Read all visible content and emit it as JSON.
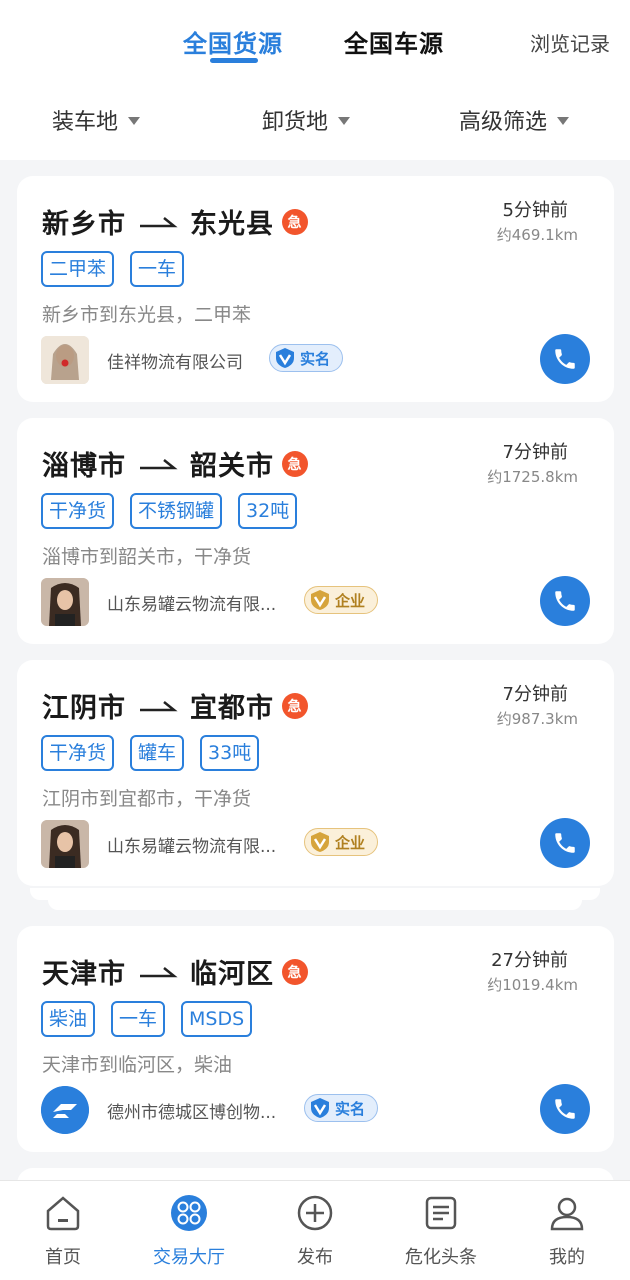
{
  "header": {
    "tabs": [
      {
        "label": "全国货源",
        "active": true
      },
      {
        "label": "全国车源",
        "active": false
      }
    ],
    "history_label": "浏览记录",
    "accent_color": "#2a7fdc"
  },
  "filters": [
    {
      "label": "装车地",
      "icon": "caret-down-icon"
    },
    {
      "label": "卸货地",
      "icon": "caret-down-icon"
    },
    {
      "label": "高级筛选",
      "icon": "caret-down-icon"
    }
  ],
  "listings": [
    {
      "from": "新乡市",
      "to": "东光县",
      "urgent_icon": "急",
      "time": "5分钟前",
      "distance": "约469.1km",
      "tags": [
        "二甲苯",
        "一车"
      ],
      "description": "新乡市到东光县，二甲苯",
      "company": "佳祥物流有限公司",
      "badge": {
        "label": "实名",
        "type": "verified"
      },
      "avatar": "photo"
    },
    {
      "from": "淄博市",
      "to": "韶关市",
      "urgent_icon": "急",
      "time": "7分钟前",
      "distance": "约1725.8km",
      "tags": [
        "干净货",
        "不锈钢罐",
        "32吨"
      ],
      "description": "淄博市到韶关市，干净货",
      "company": "山东易罐云物流有限...",
      "badge": {
        "label": "企业",
        "type": "enterprise"
      },
      "avatar": "photo"
    },
    {
      "from": "江阴市",
      "to": "宜都市",
      "urgent_icon": "急",
      "time": "7分钟前",
      "distance": "约987.3km",
      "tags": [
        "干净货",
        "罐车",
        "33吨"
      ],
      "description": "江阴市到宜都市，干净货",
      "company": "山东易罐云物流有限...",
      "badge": {
        "label": "企业",
        "type": "enterprise"
      },
      "avatar": "photo"
    },
    {
      "from": "天津市",
      "to": "临河区",
      "urgent_icon": "急",
      "time": "27分钟前",
      "distance": "约1019.4km",
      "tags": [
        "柴油",
        "一车",
        "MSDS"
      ],
      "description": "天津市到临河区，柴油",
      "company": "德州市德城区博创物...",
      "badge": {
        "label": "实名",
        "type": "verified"
      },
      "avatar": "logo"
    }
  ],
  "bottom_nav": [
    {
      "label": "首页",
      "icon": "home-icon",
      "active": false
    },
    {
      "label": "交易大厅",
      "icon": "trade-hall-icon",
      "active": true
    },
    {
      "label": "发布",
      "icon": "plus-circle-icon",
      "active": false
    },
    {
      "label": "危化头条",
      "icon": "news-icon",
      "active": false
    },
    {
      "label": "我的",
      "icon": "profile-icon",
      "active": false
    }
  ]
}
